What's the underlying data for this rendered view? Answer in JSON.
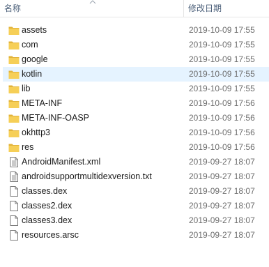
{
  "header": {
    "name_label": "名称",
    "date_label": "修改日期"
  },
  "files": [
    {
      "name": "assets",
      "date": "2019-10-09 17:55",
      "type": "folder"
    },
    {
      "name": "com",
      "date": "2019-10-09 17:55",
      "type": "folder"
    },
    {
      "name": "google",
      "date": "2019-10-09 17:55",
      "type": "folder"
    },
    {
      "name": "kotlin",
      "date": "2019-10-09 17:55",
      "type": "folder",
      "hovered": true
    },
    {
      "name": "lib",
      "date": "2019-10-09 17:55",
      "type": "folder"
    },
    {
      "name": "META-INF",
      "date": "2019-10-09 17:56",
      "type": "folder"
    },
    {
      "name": "META-INF-OASP",
      "date": "2019-10-09 17:56",
      "type": "folder"
    },
    {
      "name": "okhttp3",
      "date": "2019-10-09 17:56",
      "type": "folder"
    },
    {
      "name": "res",
      "date": "2019-10-09 17:56",
      "type": "folder"
    },
    {
      "name": "AndroidManifest.xml",
      "date": "2019-09-27 18:07",
      "type": "text-file"
    },
    {
      "name": "androidsupportmultidexversion.txt",
      "date": "2019-09-27 18:07",
      "type": "text-file"
    },
    {
      "name": "classes.dex",
      "date": "2019-09-27 18:07",
      "type": "file"
    },
    {
      "name": "classes2.dex",
      "date": "2019-09-27 18:07",
      "type": "file"
    },
    {
      "name": "classes3.dex",
      "date": "2019-09-27 18:07",
      "type": "file"
    },
    {
      "name": "resources.arsc",
      "date": "2019-09-27 18:07",
      "type": "file"
    }
  ],
  "colors": {
    "folder": "#f6cf57",
    "folder_dark": "#e2b33a",
    "hover": "#e5f3ff",
    "header_text": "#4c607a",
    "date_text": "#6d6d6d"
  }
}
